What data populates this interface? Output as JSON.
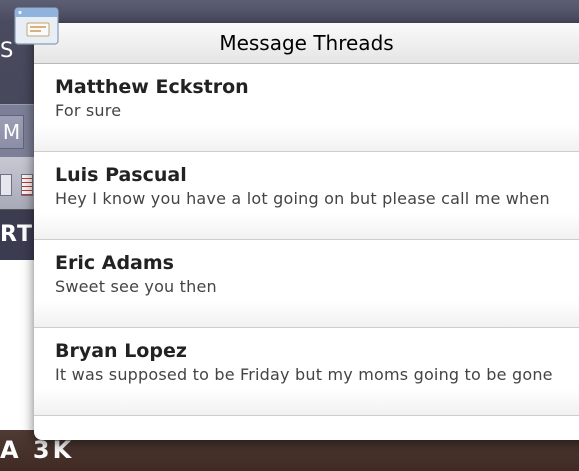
{
  "background": {
    "letter_s": "S",
    "letter_m": "M",
    "letters_rt": "RT",
    "bottom_text": "A 3K"
  },
  "popover": {
    "title": "Message Threads",
    "threads": [
      {
        "name": "Matthew Eckstron",
        "preview": "For sure"
      },
      {
        "name": "Luis Pascual",
        "preview": "Hey I know you have a lot going on but please call me when"
      },
      {
        "name": "Eric Adams",
        "preview": "Sweet see you then"
      },
      {
        "name": "Bryan Lopez",
        "preview": "It was supposed to be Friday but my moms going to be gone"
      }
    ]
  },
  "icons": {
    "app_icon": "window-icon"
  },
  "colors": {
    "title_bar": "#494a5e",
    "bottom_bar": "#3f2a24",
    "popover_bg": "#ffffff",
    "divider": "#cdcdcd"
  }
}
